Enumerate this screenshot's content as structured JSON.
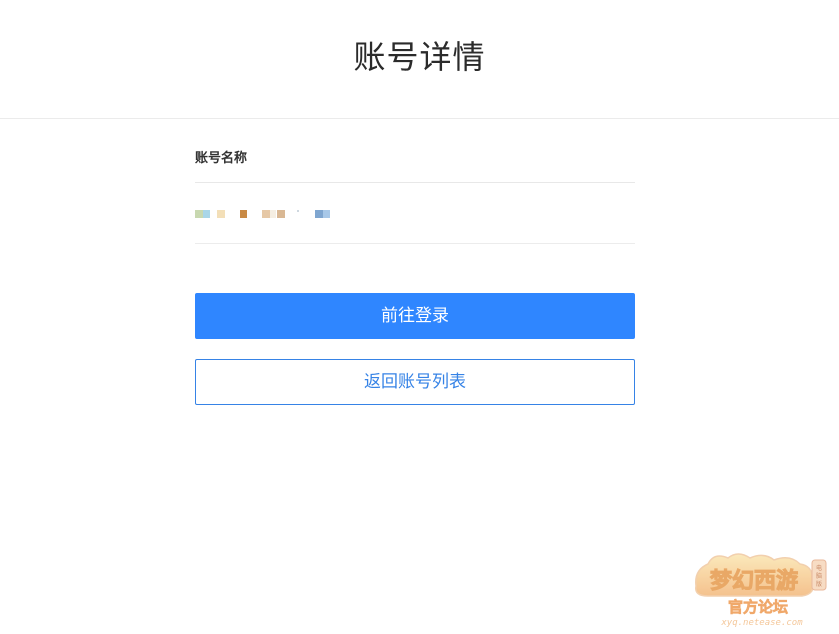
{
  "header": {
    "title": "账号详情"
  },
  "account": {
    "name_label": "账号名称",
    "name_value_masked": true
  },
  "actions": {
    "login_label": "前往登录",
    "back_label": "返回账号列表"
  },
  "watermark": {
    "logo_text": "梦幻西游",
    "subtitle": "官方论坛",
    "badge": "电脑版",
    "url": "xyq.netease.com"
  },
  "colors": {
    "primary": "#2f86ff",
    "link": "#3683e6",
    "divider": "#e8e8e8"
  }
}
